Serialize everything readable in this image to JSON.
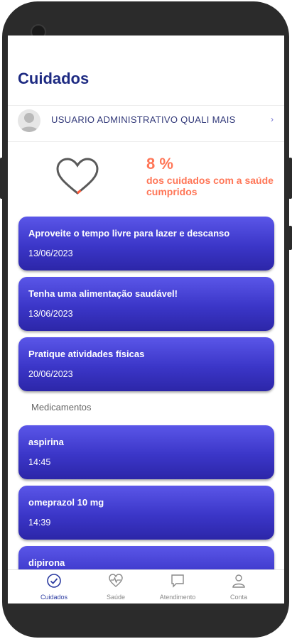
{
  "header": {
    "title": "Cuidados"
  },
  "user": {
    "name": "USUARIO ADMINISTRATIVO QUALI MAIS",
    "chevron": "›"
  },
  "progress": {
    "percent_label": "8 %",
    "value": 0.08,
    "caption": "dos cuidados com a saúde cumpridos"
  },
  "cares": [
    {
      "title": "Aproveite o tempo livre para lazer e descanso",
      "date": "13/06/2023"
    },
    {
      "title": "Tenha uma alimentação saudável!",
      "date": "13/06/2023"
    },
    {
      "title": "Pratique atividades físicas",
      "date": "20/06/2023"
    }
  ],
  "medications_header": "Medicamentos",
  "medications": [
    {
      "name": "aspirina",
      "time": "14:45"
    },
    {
      "name": "omeprazol 10 mg",
      "time": "14:39"
    },
    {
      "name": "dipirona",
      "time": ""
    }
  ],
  "tabs": [
    {
      "label": "Cuidados",
      "icon": "check-circle-icon",
      "active": true
    },
    {
      "label": "Saúde",
      "icon": "heart-pulse-icon",
      "active": false
    },
    {
      "label": "Atendimento",
      "icon": "chat-icon",
      "active": false
    },
    {
      "label": "Conta",
      "icon": "user-icon",
      "active": false
    }
  ],
  "colors": {
    "primary": "#1d2a82",
    "accent": "#ff7657",
    "card": "#3b36c8"
  }
}
